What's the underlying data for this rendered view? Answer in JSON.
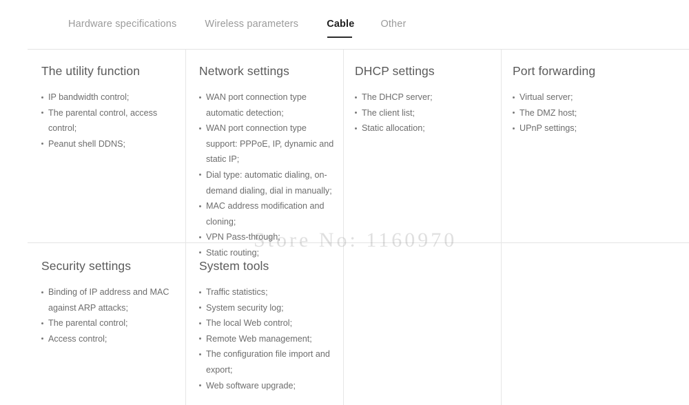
{
  "tabs": [
    {
      "label": "Hardware specifications",
      "active": false
    },
    {
      "label": "Wireless parameters",
      "active": false
    },
    {
      "label": "Cable",
      "active": true
    },
    {
      "label": "Other",
      "active": false
    }
  ],
  "panels": {
    "utility": {
      "title": "The utility function",
      "items": [
        "IP bandwidth control;",
        "The parental control, access control;",
        "Peanut shell DDNS;"
      ]
    },
    "network": {
      "title": "Network settings",
      "items": [
        "WAN port connection type automatic detection;",
        "WAN port connection type support: PPPoE, IP, dynamic and static IP;",
        "Dial type: automatic dialing, on-demand dialing, dial in manually;",
        "MAC address modification and cloning;",
        "VPN Pass-through;",
        "Static routing;"
      ]
    },
    "dhcp": {
      "title": "DHCP settings",
      "items": [
        "The DHCP server;",
        "The client list;",
        "Static allocation;"
      ]
    },
    "port_forwarding": {
      "title": "Port forwarding",
      "items": [
        "Virtual server;",
        "The DMZ host;",
        "UPnP settings;"
      ]
    },
    "security": {
      "title": "Security settings",
      "items": [
        "Binding of IP address and MAC against ARP attacks;",
        "The parental control;",
        "Access control;"
      ]
    },
    "system_tools": {
      "title": "System tools",
      "items": [
        "Traffic statistics;",
        "System security log;",
        "The local Web control;",
        "Remote Web management;",
        "The configuration file import and export;",
        "Web software upgrade;"
      ]
    }
  },
  "watermark": {
    "text": "Store No: 1160970"
  },
  "colors": {
    "active_tab": "#1f1f1f",
    "inactive_tab": "#9b9b9b",
    "heading": "#5a5a5a",
    "body_text": "#6d6d6d",
    "rule": "#e3e3e3",
    "background": "#ffffff"
  }
}
